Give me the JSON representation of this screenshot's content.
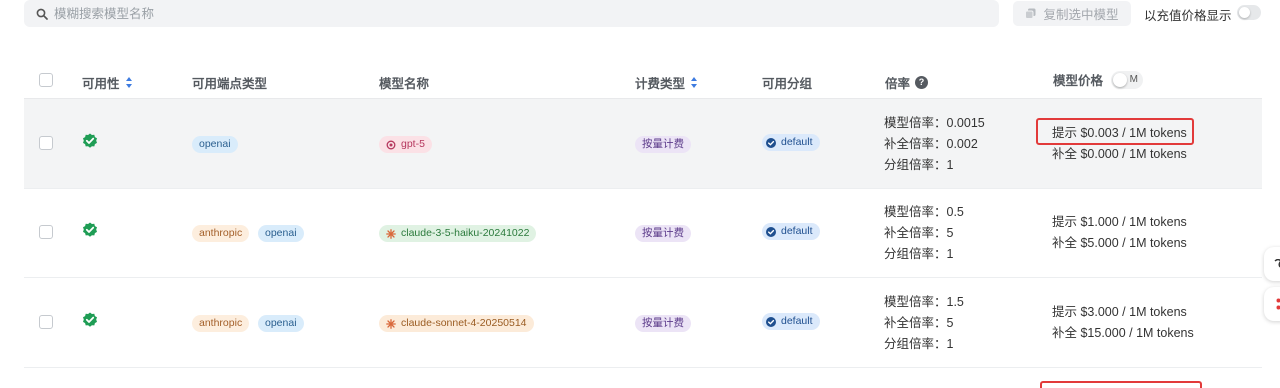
{
  "toolbar": {
    "search_placeholder": "模糊搜索模型名称",
    "copy_label": "复制选中模型",
    "recharge_toggle_label": "以充值价格显示"
  },
  "columns": {
    "availability": "可用性",
    "endpoint_types": "可用端点类型",
    "model_name": "模型名称",
    "billing_type": "计费类型",
    "groups": "可用分组",
    "ratio": "倍率",
    "price": "模型价格",
    "price_unit_toggle": "M"
  },
  "rows": [
    {
      "endpoints": [
        "openai"
      ],
      "model": "gpt-5",
      "billing": "按量计费",
      "group": "default",
      "ratio_model": "模型倍率：0.0015",
      "ratio_completion": "补全倍率：0.002",
      "ratio_group": "分组倍率：1",
      "price_prompt": "提示 $0.003 / 1M tokens",
      "price_completion": "补全 $0.000 / 1M tokens"
    },
    {
      "endpoints": [
        "anthropic",
        "openai"
      ],
      "model": "claude-3-5-haiku-20241022",
      "billing": "按量计费",
      "group": "default",
      "ratio_model": "模型倍率：0.5",
      "ratio_completion": "补全倍率：5",
      "ratio_group": "分组倍率：1",
      "price_prompt": "提示 $1.000 / 1M tokens",
      "price_completion": "补全 $5.000 / 1M tokens"
    },
    {
      "endpoints": [
        "anthropic",
        "openai"
      ],
      "model": "claude-sonnet-4-20250514",
      "billing": "按量计费",
      "group": "default",
      "ratio_model": "模型倍率：1.5",
      "ratio_completion": "补全倍率：5",
      "ratio_group": "分组倍率：1",
      "price_prompt": "提示 $3.000 / 1M tokens",
      "price_completion": "补全 $15.000 / 1M tokens"
    }
  ],
  "colors": {
    "available_check": "#1f9d55",
    "highlight_box": "#e23a3a",
    "sort_icon": "#3d7be0"
  }
}
